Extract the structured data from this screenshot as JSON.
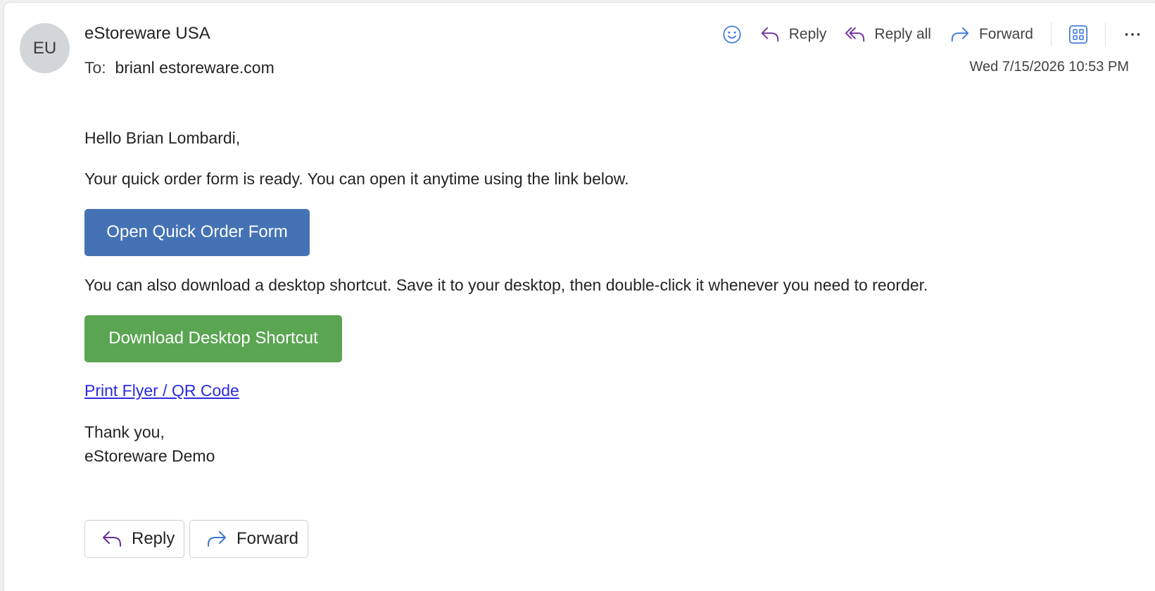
{
  "sender": {
    "initials": "EU",
    "name": "eStoreware USA"
  },
  "recipient": {
    "label": "To:",
    "address": "brianl estoreware.com"
  },
  "date": "Wed 7/15/2026 10:53 PM",
  "toolbar": {
    "emoji_icon": "smiley-icon",
    "reply_label": "Reply",
    "reply_all_label": "Reply all",
    "forward_label": "Forward",
    "apps_icon": "grid-icon",
    "more_icon": "more-icon"
  },
  "body": {
    "greeting": "Hello Brian Lombardi,",
    "paragraph1": "Your quick order form is ready. You can open it anytime using the link below.",
    "open_button": "Open Quick Order Form",
    "paragraph2": "You can also download a desktop shortcut. Save it to your desktop, then double-click it whenever you need to reorder.",
    "download_button": "Download Desktop Shortcut",
    "print_link": "Print Flyer / QR Code",
    "signoff": "Thank you,",
    "signature": "eStoreware Demo"
  },
  "footer": {
    "reply_label": "Reply",
    "forward_label": "Forward"
  },
  "colors": {
    "accent_purple": "#6b2e9b",
    "accent_blue": "#3b76d6",
    "open_button_bg": "#4472b4",
    "download_button_bg": "#5aa552",
    "link": "#2b2ae0"
  }
}
